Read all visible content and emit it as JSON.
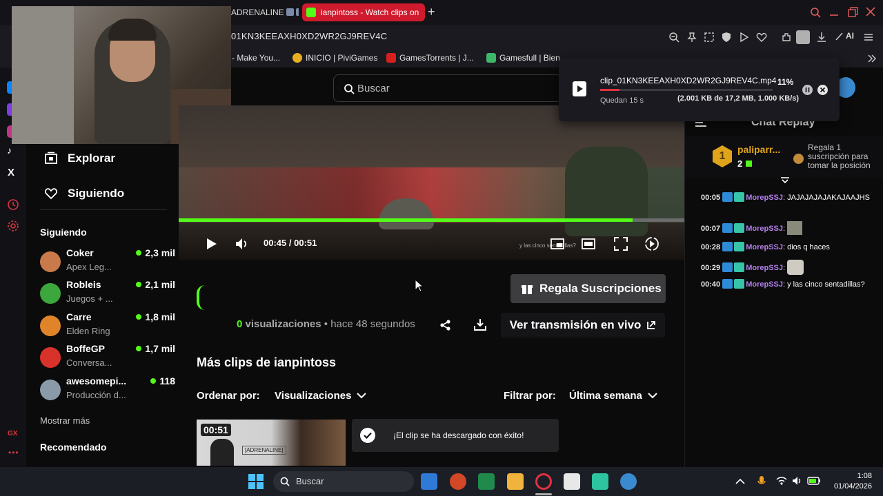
{
  "browser": {
    "tabs": [
      {
        "label": "ADRENALINE",
        "active": false
      },
      {
        "label": "ianpintoss - Watch clips on",
        "active": true
      }
    ],
    "new_tab_icon": "plus-icon",
    "url": "01KN3KEEAXH0XD2WR2GJ9REV4C",
    "ai_label": "AI",
    "bookmarks": [
      {
        "label": "- Make You...",
        "icon": "youtube-icon"
      },
      {
        "label": "INICIO | PiviGames",
        "icon": "pivigames-icon"
      },
      {
        "label": "GamesTorrents | J...",
        "icon": "gamestorrents-icon"
      },
      {
        "label": "Gamesfull | Bien",
        "icon": "gamepad-icon"
      }
    ]
  },
  "download": {
    "filename": "clip_01KN3KEEAXH0XD2WR2GJ9REV4C.mp4",
    "percent": "11%",
    "progress": 0.11,
    "remaining": "Quedan 15 s",
    "detail": "(2.001 KB de 17,2 MB, 1.000 KB/s)"
  },
  "search": {
    "placeholder": "Buscar"
  },
  "sidebar": {
    "nav": [
      {
        "label": "Explorar",
        "icon": "compass-icon"
      },
      {
        "label": "Siguiendo",
        "icon": "heart-icon"
      }
    ],
    "following_heading": "Siguiendo",
    "channels": [
      {
        "name": "Coker",
        "game": "Apex Leg...",
        "viewers": "2,3 mil",
        "color": "#c97a4a"
      },
      {
        "name": "Robleis",
        "game": "Juegos + ...",
        "viewers": "2,1 mil",
        "color": "#3ca73c"
      },
      {
        "name": "Carre",
        "game": "Elden Ring",
        "viewers": "1,8 mil",
        "color": "#e0842a"
      },
      {
        "name": "BoffeGP",
        "game": "Conversa...",
        "viewers": "1,7 mil",
        "color": "#d8322a"
      },
      {
        "name": "awesomepi...",
        "game": "Producción d...",
        "viewers": "118",
        "color": "#8a9aa8"
      }
    ],
    "show_more": "Mostrar más",
    "recommended_heading": "Recomendado"
  },
  "player": {
    "current_time": "00:45",
    "separator": "/",
    "duration": "00:51",
    "progress": 0.898,
    "watermark": "y las cinco sentadillas?"
  },
  "clip": {
    "gift_button": "Regala Suscripciones",
    "views_count": "0",
    "views_label": "visualizaciones",
    "dot": "•",
    "time_ago": "hace 48 segundos",
    "watch_live": "Ver transmisión en vivo",
    "more_clips": "Más clips de ianpintoss",
    "sort_label": "Ordenar por:",
    "sort_value": "Visualizaciones",
    "filter_label": "Filtrar por:",
    "filter_value": "Última semana",
    "thumb_duration": "00:51",
    "thumb_text": "[ADRENALINE]"
  },
  "toast": {
    "message": "¡El clip se ha descargado con éxito!"
  },
  "chat": {
    "title": "Chat Replay",
    "pinned": {
      "rank": "1",
      "user": "paliparr...",
      "count": "2",
      "gift_text": "Regala 1 suscripción para tomar la posición"
    },
    "messages": [
      {
        "time": "00:05",
        "user": "MorepSSJ",
        "text": "JAJAJAJAJAKAJAAJHS",
        "emote": ""
      },
      {
        "time": "00:07",
        "user": "MorepSSJ",
        "text": "",
        "emote": "pepe"
      },
      {
        "time": "00:28",
        "user": "MorepSSJ",
        "text": "dios q haces",
        "emote": ""
      },
      {
        "time": "00:29",
        "user": "MorepSSJ",
        "text": "",
        "emote": "cat"
      },
      {
        "time": "00:40",
        "user": "MorepSSJ",
        "text": "y las cinco sentadillas?",
        "emote": ""
      }
    ]
  },
  "taskbar": {
    "search": "Buscar",
    "time": "1:08",
    "date": "01/04/2026"
  },
  "colors": {
    "accent": "#53fc18",
    "opera_red": "#cf1b2d",
    "chat_user": "#b37feb"
  }
}
